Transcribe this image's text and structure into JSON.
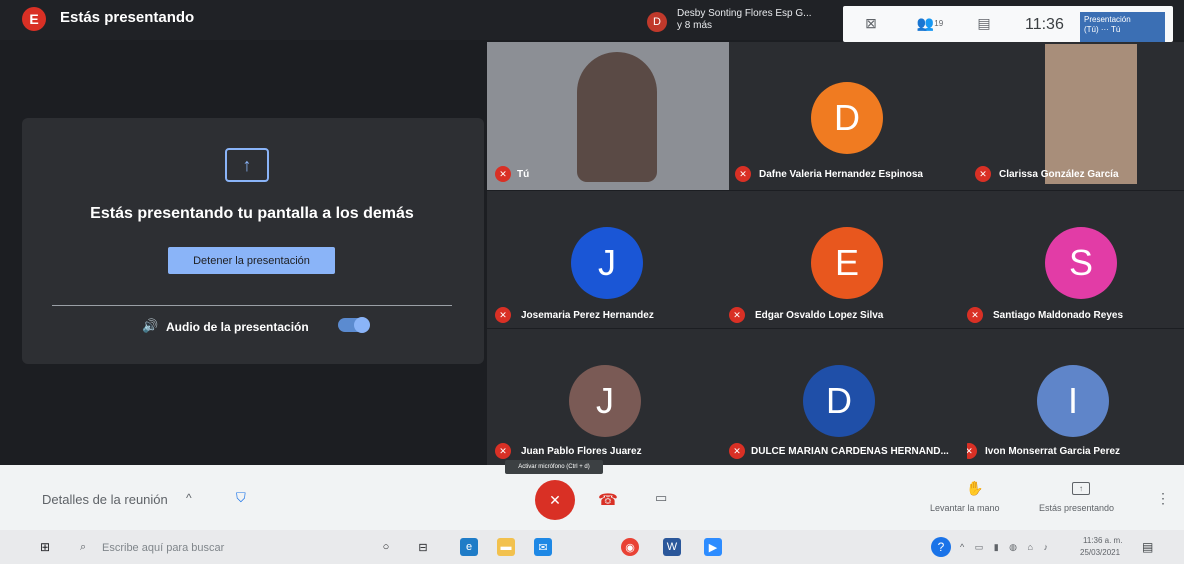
{
  "top_bar": {
    "avatar_letter": "E",
    "title": "Estás presentando",
    "presenter_avatar": "D",
    "presenter_names_line1": "Desby Sonting Flores Esp G...",
    "presenter_names_line2": "y 8 más",
    "participants_count": "19",
    "time": "11:36",
    "thumb_label": "Presentación",
    "thumb_you": "(Tú)",
    "thumb_you_short": "Tú"
  },
  "share_panel": {
    "message": "Estás presentando tu pantalla a los demás",
    "stop_button": "Detener la presentación",
    "audio_label": "Audio de la presentación",
    "audio_enabled": true
  },
  "participants": [
    {
      "name": "Tú",
      "type": "photo",
      "color": "#8c8f95"
    },
    {
      "name": "Dafne Valeria Hernandez Espinosa",
      "letter": "D",
      "color": "#f07b21"
    },
    {
      "name": "Clarissa González García",
      "type": "photo",
      "color": "#a88e7a"
    },
    {
      "name": "Josemaria Perez Hernandez",
      "letter": "J",
      "color": "#1a56d6"
    },
    {
      "name": "Edgar Osvaldo Lopez Silva",
      "letter": "E",
      "color": "#e8571e"
    },
    {
      "name": "Santiago Maldonado Reyes",
      "letter": "S",
      "color": "#e23ca6"
    },
    {
      "name": "Juan Pablo Flores Juarez",
      "letter": "J",
      "color": "#7a5a55"
    },
    {
      "name": "DULCE MARIAN CARDENAS HERNAND...",
      "letter": "D",
      "color": "#1f4fa8"
    },
    {
      "name": "Ivon Monserrat Garcia Perez",
      "letter": "I",
      "color": "#5f85c9"
    }
  ],
  "bottom_bar": {
    "details_label": "Detalles de la reunión",
    "mic_tooltip": "Activar micrófono (Ctrl + d)",
    "raise_hand_label": "Levantar la mano",
    "presenting_label": "Estás presentando"
  },
  "taskbar": {
    "search_placeholder": "Escribe aquí para buscar",
    "clock_time": "11:36 a. m.",
    "clock_date": "25/03/2021"
  },
  "colors": {
    "accent": "#8ab4f8",
    "mic_off": "#d93025"
  },
  "icons": [
    "windows-icon",
    "search-icon",
    "shield-icon",
    "mic-off-icon",
    "hangup-icon",
    "camera-icon",
    "raise-hand-icon",
    "present-icon",
    "more-icon",
    "speaker-icon",
    "share-screen-icon",
    "help-icon"
  ]
}
